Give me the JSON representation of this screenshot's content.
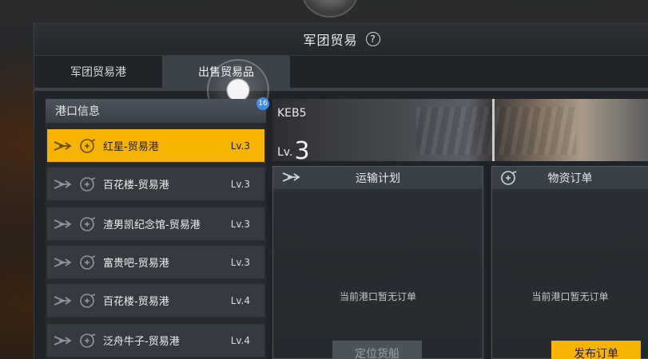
{
  "window": {
    "title": "军团贸易",
    "help_glyph": "?"
  },
  "tabs": [
    {
      "label": "军团贸易港",
      "active": false
    },
    {
      "label": "出售贸易品",
      "active": true
    }
  ],
  "port_panel": {
    "header": "港口信息",
    "badge_count": "16",
    "ports": [
      {
        "name": "红星-贸易港",
        "level": "Lv.3",
        "selected": true
      },
      {
        "name": "百花楼-贸易港",
        "level": "Lv.3",
        "selected": false
      },
      {
        "name": "渣男凯纪念馆-贸易港",
        "level": "Lv.3",
        "selected": false
      },
      {
        "name": "富贵吧-贸易港",
        "level": "Lv.3",
        "selected": false
      },
      {
        "name": "百花楼-贸易港",
        "level": "Lv.4",
        "selected": false
      },
      {
        "name": "泛舟牛子-贸易港",
        "level": "Lv.4",
        "selected": false
      }
    ],
    "icons": [
      "ship-icon",
      "trade-icon"
    ]
  },
  "banner": {
    "code": "KEB5",
    "level_prefix": "Lv.",
    "level_value": "3"
  },
  "transport": {
    "title": "运输计划",
    "icon": "ship-icon",
    "empty_text": "当前港口暂无订单",
    "button": "定位货船"
  },
  "orders": {
    "title": "物资订单",
    "icon": "trade-icon",
    "empty_text": "当前港口暂无订单",
    "button": "发布订单"
  },
  "colors": {
    "accent": "#f6b300",
    "badge": "#3f8ee8",
    "panel": "#353a40"
  }
}
